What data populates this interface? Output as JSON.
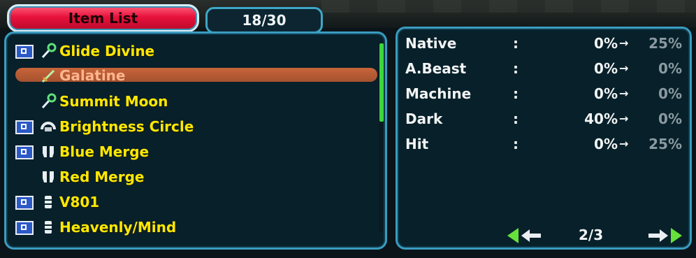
{
  "header": {
    "tab_title": "Item List",
    "count": "18/30"
  },
  "items": [
    {
      "label": "Glide Divine",
      "icon": "wand-icon",
      "tagged": true
    },
    {
      "label": "Galatine",
      "icon": "sword-icon",
      "tagged": false,
      "selected": true
    },
    {
      "label": "Summit Moon",
      "icon": "wand-icon",
      "tagged": false
    },
    {
      "label": "Brightness Circle",
      "icon": "circle-icon",
      "tagged": true
    },
    {
      "label": "Blue Merge",
      "icon": "armor-icon",
      "tagged": true
    },
    {
      "label": "Red Merge",
      "icon": "armor-icon",
      "tagged": false
    },
    {
      "label": "V801",
      "icon": "unit-icon",
      "tagged": true
    },
    {
      "label": "Heavenly/Mind",
      "icon": "unit-icon",
      "tagged": true
    }
  ],
  "stats": [
    {
      "name": "Native",
      "colon": ":",
      "current": "0%",
      "arrow": "→",
      "next": "25%"
    },
    {
      "name": "A.Beast",
      "colon": ":",
      "current": "0%",
      "arrow": "→",
      "next": "0%"
    },
    {
      "name": "Machine",
      "colon": ":",
      "current": "0%",
      "arrow": "→",
      "next": "0%"
    },
    {
      "name": "Dark",
      "colon": ":",
      "current": "40%",
      "arrow": "→",
      "next": "0%"
    },
    {
      "name": "Hit",
      "colon": ":",
      "current": "0%",
      "arrow": "→",
      "next": "25%"
    }
  ],
  "pager": {
    "page": "2/3"
  },
  "colors": {
    "tab_active": "#e8123c",
    "item_text": "#ffe800",
    "selected_text": "#ffb48e",
    "selection_bar": "#c8643a",
    "frame": "#3a9cc0",
    "scroll_thumb": "#3cd63c"
  }
}
